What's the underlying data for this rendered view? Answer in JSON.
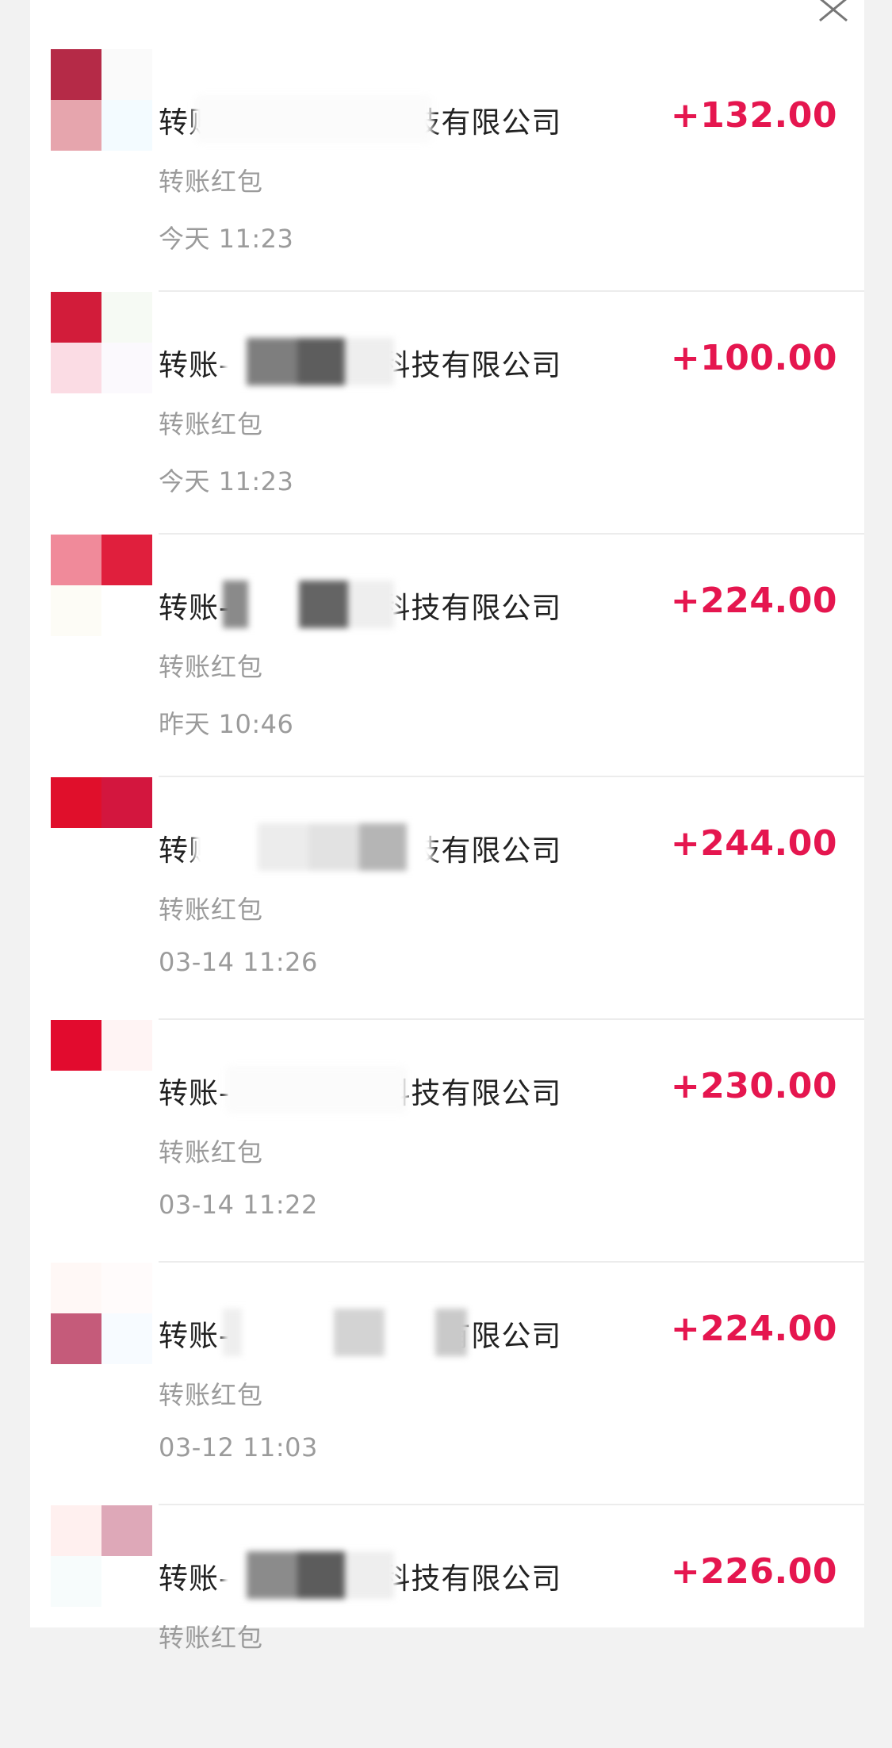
{
  "records": [
    {
      "title": "转账-ＸＸＸＸＸ科技有限公司",
      "amount": "+132.00",
      "subtitle": "转账红包",
      "time": "今天 11:23"
    },
    {
      "title": "转账-ＸＸＸＸＸ科技有限公司",
      "amount": "+100.00",
      "subtitle": "转账红包",
      "time": "今天 11:23"
    },
    {
      "title": "转账-ＸＸＸＸＸ科技有限公司",
      "amount": "+224.00",
      "subtitle": "转账红包",
      "time": "昨天 10:46"
    },
    {
      "title": "转账-ＸＸＸＸＸ科技有限公司",
      "amount": "+244.00",
      "subtitle": "转账红包",
      "time": "03-14 11:26"
    },
    {
      "title": "转账-ＸＸＸＸＸ科技有限公司",
      "amount": "+230.00",
      "subtitle": "转账红包",
      "time": "03-14 11:22"
    },
    {
      "title": "转账-ＸＸＸＸＸ科技有限公司",
      "amount": "+224.00",
      "subtitle": "转账红包",
      "time": "03-12 11:03"
    },
    {
      "title": "转账-ＸＸＸＸＸ科技有限公司",
      "amount": "+226.00",
      "subtitle": "转账红包",
      "time": ""
    }
  ],
  "colors": {
    "amount": "#e5164f",
    "title": "#222222",
    "secondary": "#9b9b9b",
    "divider": "#ececec"
  },
  "icons": {
    "close": "close-icon"
  }
}
